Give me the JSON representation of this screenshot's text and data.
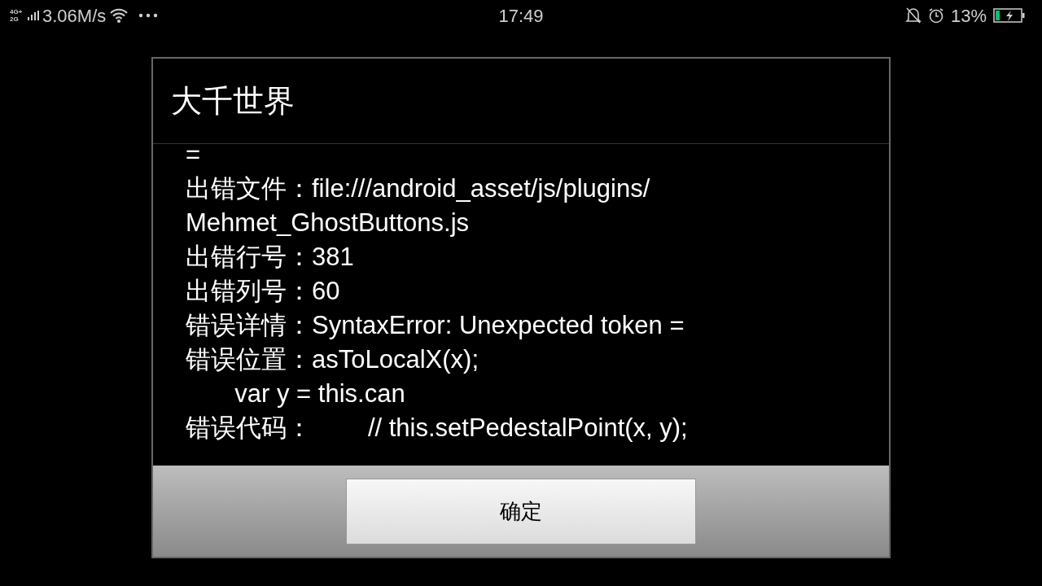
{
  "status_bar": {
    "network": [
      "4G+",
      "2G"
    ],
    "speed": "3.06M/s",
    "time": "17:49",
    "battery": "13%"
  },
  "dialog": {
    "title": "大千世界",
    "lines": [
      "=",
      "出错文件：file:///android_asset/js/plugins/",
      "Mehmet_GhostButtons.js",
      "出错行号：381",
      "出错列号：60",
      "错误详情：SyntaxError: Unexpected token =",
      "错误位置：asToLocalX(x);",
      "       var y = this.can",
      "错误代码：        // this.setPedestalPoint(x, y);"
    ],
    "button": "确定"
  }
}
